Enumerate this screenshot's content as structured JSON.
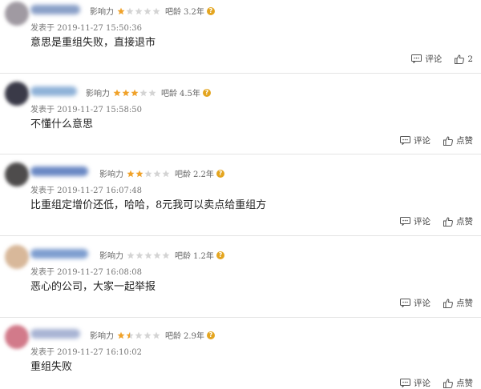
{
  "labels": {
    "influence": "影响力",
    "age": "吧龄",
    "comment": "评论",
    "like": "点赞"
  },
  "colors": {
    "star_on": "#f0a22a",
    "star_off": "#d4d4d4",
    "help": "#e4a51f"
  },
  "posts": [
    {
      "rating": 1,
      "age": "3.2年",
      "date": "发表于 2019-11-27 15:50:36",
      "content": "意思是重组失败，直接退市",
      "like_count": "2",
      "avatar_color": "#a09aa2",
      "name_color": "#8aa0c8"
    },
    {
      "rating": 3,
      "age": "4.5年",
      "date": "发表于 2019-11-27 15:58:50",
      "content": "不懂什么意思",
      "like_count": "",
      "avatar_color": "#3a3a48",
      "name_color": "#8fb2d8"
    },
    {
      "rating": 2,
      "age": "2.2年",
      "date": "发表于 2019-11-27 16:07:48",
      "content": "比重组定增价还低，哈哈，8元我可以卖点给重组方",
      "like_count": "",
      "avatar_color": "#4e4c4c",
      "name_color": "#6a88c4"
    },
    {
      "rating": 0,
      "age": "1.2年",
      "date": "发表于 2019-11-27 16:08:08",
      "content": "恶心的公司，大家一起举报",
      "like_count": "",
      "avatar_color": "#d8b89a",
      "name_color": "#7e9ed0"
    },
    {
      "rating": 1.5,
      "age": "2.9年",
      "date": "发表于 2019-11-27 16:10:02",
      "content": "重组失败",
      "like_count": "",
      "avatar_color": "#d27a8a",
      "name_color": "#a8b4d4"
    }
  ]
}
